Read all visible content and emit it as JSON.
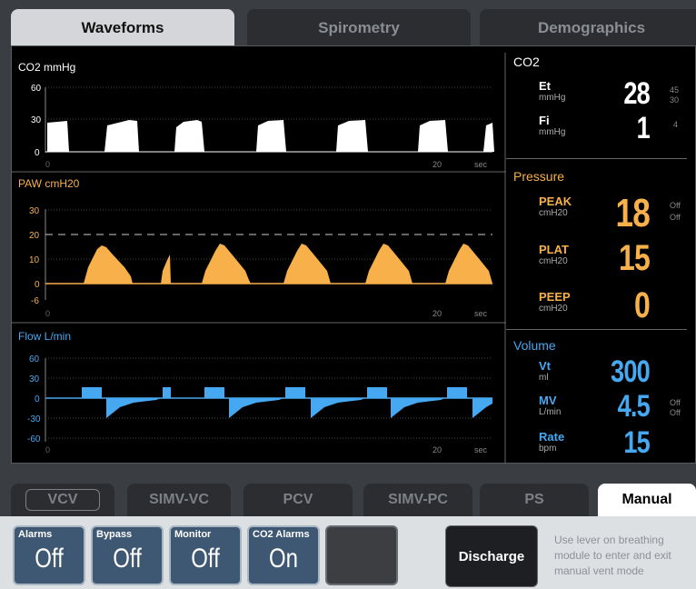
{
  "tabs": {
    "waveforms": "Waveforms",
    "spirometry": "Spirometry",
    "demographics": "Demographics"
  },
  "waves": {
    "co2": {
      "title": "CO2 mmHg",
      "ticks": [
        "60",
        "30",
        "0"
      ],
      "x_ticks": [
        "0",
        "20",
        "sec"
      ],
      "color": "#ffffff"
    },
    "paw": {
      "title": "PAW cmH20",
      "ticks": [
        "30",
        "20",
        "10",
        "0",
        "-6"
      ],
      "x_ticks": [
        "0",
        "20",
        "sec"
      ],
      "color": "#f7b04a"
    },
    "flow": {
      "title": "Flow L/min",
      "ticks": [
        "60",
        "30",
        "0",
        "-30",
        "-60"
      ],
      "x_ticks": [
        "0",
        "20",
        "sec"
      ],
      "color": "#46a8f0"
    }
  },
  "co2": {
    "title": "CO2",
    "et": {
      "label": "Et",
      "unit": "mmHg",
      "value": "28",
      "limit_hi": "45",
      "limit_lo": "30"
    },
    "fi": {
      "label": "Fi",
      "unit": "mmHg",
      "value": "1",
      "limit": "4"
    }
  },
  "pressure": {
    "title": "Pressure",
    "peak": {
      "label": "PEAK",
      "unit": "cmH20",
      "value": "18",
      "limit_hi": "Off",
      "limit_lo": "Off"
    },
    "plat": {
      "label": "PLAT",
      "unit": "cmH20",
      "value": "15"
    },
    "peep": {
      "label": "PEEP",
      "unit": "cmH20",
      "value": "0"
    }
  },
  "volume": {
    "title": "Volume",
    "vt": {
      "label": "Vt",
      "unit": "ml",
      "value": "300"
    },
    "mv": {
      "label": "MV",
      "unit": "L/min",
      "value": "4.5",
      "limit_hi": "Off",
      "limit_lo": "Off"
    },
    "rate": {
      "label": "Rate",
      "unit": "bpm",
      "value": "15"
    }
  },
  "modes": {
    "vcv": "VCV",
    "simv_vc": "SIMV-VC",
    "pcv": "PCV",
    "simv_pc": "SIMV-PC",
    "ps": "PS",
    "manual": "Manual"
  },
  "buttons": {
    "alarms": {
      "label": "Alarms",
      "value": "Off"
    },
    "bypass": {
      "label": "Bypass",
      "value": "Off"
    },
    "monitor": {
      "label": "Monitor",
      "value": "Off"
    },
    "co2_alarms": {
      "label": "CO2 Alarms",
      "value": "On"
    },
    "discharge": "Discharge"
  },
  "note": "Use lever on breathing module to enter and exit manual vent mode",
  "colors": {
    "co2": "#ffffff",
    "pressure": "#f7b04a",
    "volume": "#46a8f0",
    "active_tab": "#d4d6d9",
    "button": "#3e5873"
  }
}
